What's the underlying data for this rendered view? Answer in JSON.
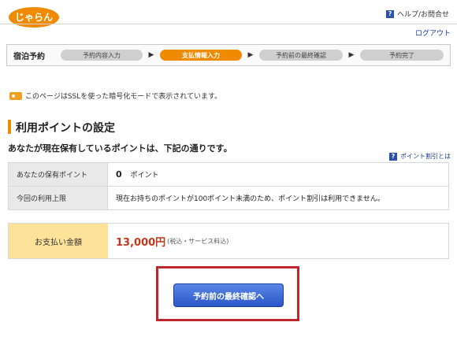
{
  "header": {
    "logo_name": "jalan-logo",
    "help_label": "ヘルプ/お問合せ",
    "logout_label": "ログアウト"
  },
  "steps": {
    "title": "宿泊予約",
    "items": [
      {
        "label": "予約内容入力",
        "active": false
      },
      {
        "label": "支払情報入力",
        "active": true
      },
      {
        "label": "予約前の最終確認",
        "active": false
      },
      {
        "label": "予約完了",
        "active": false
      }
    ]
  },
  "ssl_notice": "このページはSSLを使った暗号化モードで表示されています。",
  "points": {
    "section_title": "利用ポイントの設定",
    "intro": "あなたが現在保有しているポイントは、下記の通りです。",
    "discount_help": "ポイント割引とは",
    "held_label": "あなたの保有ポイント",
    "held_value": "0",
    "held_unit": "ポイント",
    "limit_label": "今回の利用上限",
    "limit_text": "現在お持ちのポイントが100ポイント未満のため、ポイント割引は利用できません。"
  },
  "payment": {
    "label": "お支払い金額",
    "amount": "13,000円",
    "tax_note": "(税込・サービス料込)"
  },
  "confirm_button": "予約前の最終確認へ",
  "colors": {
    "accent": "#f08a00",
    "link": "#1a3c9c",
    "amount": "#c0391b",
    "highlight": "#c0262d"
  }
}
